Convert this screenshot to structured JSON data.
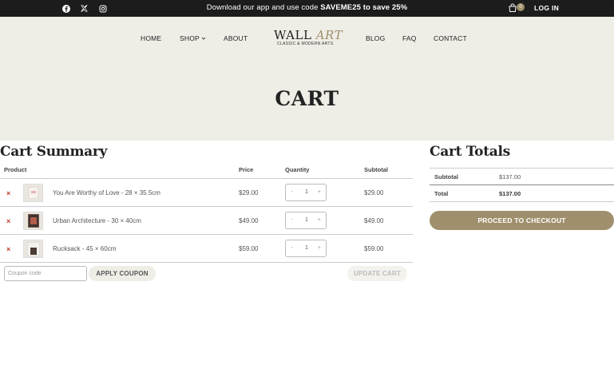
{
  "topbar": {
    "promo_prefix": "Download our app and use code ",
    "promo_code": "SAVEME25",
    "promo_suffix": " to save 25%",
    "cart_count": "0",
    "login_label": "LOG IN"
  },
  "nav": {
    "home": "HOME",
    "shop": "SHOP",
    "about": "ABOUT",
    "blog": "BLOG",
    "faq": "FAQ",
    "contact": "CONTACT"
  },
  "logo": {
    "word1": "WALL",
    "word2": "ART",
    "tagline": "CLASSIC & MODERN ARTS"
  },
  "page_title": "CART",
  "cart_summary": {
    "title": "Cart Summary",
    "headers": {
      "product": "Product",
      "price": "Price",
      "quantity": "Quantity",
      "subtotal": "Subtotal"
    },
    "items": [
      {
        "name": "You Are Worthy of Love - 28 × 35.5cm",
        "price": "$29.00",
        "qty": "1",
        "subtotal": "$29.00"
      },
      {
        "name": "Urban Architecture - 30 × 40cm",
        "price": "$49.00",
        "qty": "1",
        "subtotal": "$49.00"
      },
      {
        "name": "Rucksack - 45 × 60cm",
        "price": "$59.00",
        "qty": "1",
        "subtotal": "$59.00"
      }
    ],
    "remove_symbol": "×",
    "minus_symbol": "-",
    "plus_symbol": "+",
    "coupon_placeholder": "Coupon code",
    "apply_coupon_label": "APPLY COUPON",
    "update_cart_label": "UPDATE CART"
  },
  "cart_totals": {
    "title": "Cart Totals",
    "subtotal_label": "Subtotal",
    "subtotal_value": "$137.00",
    "total_label": "Total",
    "total_value": "$137.00",
    "checkout_label": "PROCEED TO CHECKOUT"
  },
  "colors": {
    "accent": "#a08f6c",
    "topbar_bg": "#1c1c1c",
    "hero_bg": "#eeede6",
    "remove": "#c0392b"
  }
}
